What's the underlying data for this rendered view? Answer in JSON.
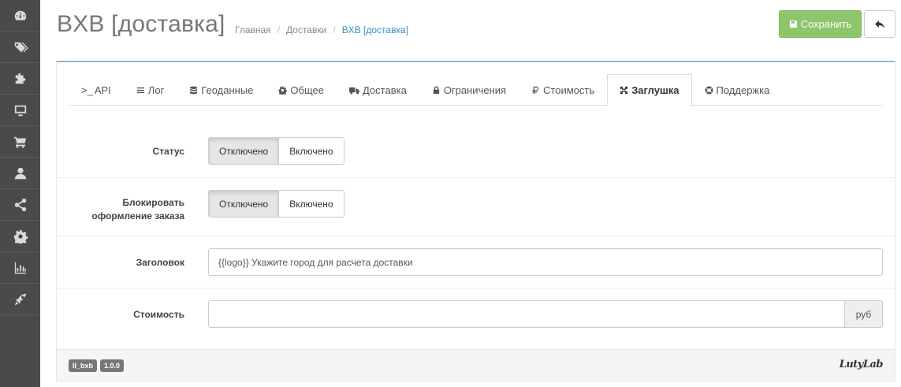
{
  "sidebar": {
    "items": [
      {
        "icon": "dashboard-icon"
      },
      {
        "icon": "tags-icon"
      },
      {
        "icon": "puzzle-icon"
      },
      {
        "icon": "desktop-icon"
      },
      {
        "icon": "cart-icon"
      },
      {
        "icon": "user-icon"
      },
      {
        "icon": "share-icon"
      },
      {
        "icon": "cog-icon"
      },
      {
        "icon": "bar-chart-icon"
      },
      {
        "icon": "rocket-icon"
      }
    ]
  },
  "header": {
    "title": "BXB [доставка]",
    "breadcrumbs": [
      "Главная",
      "Доставки",
      "BXB [доставка]"
    ],
    "breadcrumb_separator": "/",
    "save_label": "Сохранить",
    "back_icon": "reply-icon"
  },
  "tabs": [
    {
      "label": "API",
      "icon": "terminal-icon",
      "prefix": ">_"
    },
    {
      "label": "Лог",
      "icon": "list-icon"
    },
    {
      "label": "Геоданные",
      "icon": "database-icon"
    },
    {
      "label": "Общее",
      "icon": "cog-icon"
    },
    {
      "label": "Доставка",
      "icon": "truck-icon"
    },
    {
      "label": "Ограничения",
      "icon": "lock-icon"
    },
    {
      "label": "Стоимость",
      "icon": "ruble-icon"
    },
    {
      "label": "Заглушка",
      "icon": "arrows-icon",
      "active": true
    },
    {
      "label": "Поддержка",
      "icon": "lifering-icon"
    }
  ],
  "form": {
    "status": {
      "label": "Статус",
      "options": [
        "Отключено",
        "Включено"
      ],
      "selected": "Отключено"
    },
    "block_checkout": {
      "label": "Блокировать оформление заказа",
      "options": [
        "Отключено",
        "Включено"
      ],
      "selected": "Отключено"
    },
    "heading": {
      "label": "Заголовок",
      "value": "{{logo}} Укажите город для расчета доставки"
    },
    "cost": {
      "label": "Стоимость",
      "value": "",
      "unit": "руб"
    }
  },
  "footer": {
    "module_code": "ll_bxb",
    "version": "1.0.0",
    "brand": "LutyLab"
  },
  "colors": {
    "sidebar_bg": "#4a4a4a",
    "save_green": "#8fc56d",
    "link_blue": "#3a8fc4",
    "panel_top_border": "#8fb8cc"
  }
}
